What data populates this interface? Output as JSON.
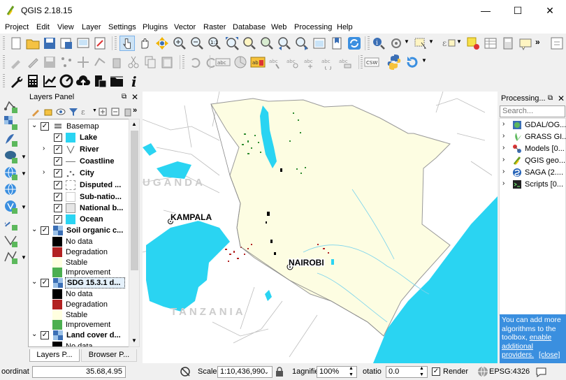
{
  "window": {
    "title": "QGIS 2.18.15",
    "minimize_glyph": "—",
    "maximize_glyph": "☐",
    "close_glyph": "✕"
  },
  "menu": [
    "Project",
    "Edit",
    "View",
    "Layer",
    "Settings",
    "Plugins",
    "Vector",
    "Raster",
    "Database",
    "Web",
    "Processing",
    "Help"
  ],
  "layers_panel": {
    "title": "Layers Panel",
    "layers": [
      {
        "name": "Basemap",
        "type": "group"
      },
      {
        "name": "Lake",
        "type": "layer"
      },
      {
        "name": "River",
        "type": "layer"
      },
      {
        "name": "Coastline",
        "type": "layer"
      },
      {
        "name": "City",
        "type": "layer"
      },
      {
        "name": "Disputed ...",
        "type": "layer"
      },
      {
        "name": "Sub-natio...",
        "type": "layer"
      },
      {
        "name": "National b...",
        "type": "layer"
      },
      {
        "name": "Ocean",
        "type": "layer"
      },
      {
        "name": "Soil organic c...",
        "type": "raster"
      },
      {
        "name": "SDG 15.3.1 d...",
        "type": "raster"
      },
      {
        "name": "Land cover d...",
        "type": "raster"
      }
    ],
    "legend_items": [
      "No data",
      "Degradation",
      "Stable",
      "Improvement"
    ],
    "legend_colors": {
      "no_data": "#000000",
      "degradation": "#b22222",
      "stable": "#ffffe0",
      "improvement": "#4caf50"
    },
    "tabs": [
      "Layers P...",
      "Browser P..."
    ]
  },
  "map": {
    "labels": {
      "kampala": "KAMPALA",
      "nairobi": "NAIROBI",
      "uganda": "UGANDA",
      "tanzania": "TANZANIA"
    },
    "colors": {
      "water": "#2ad4f2",
      "kenya": "#fdfde2",
      "border": "#999999",
      "background": "#ffffff"
    }
  },
  "processing": {
    "title": "Processing...",
    "search_placeholder": "Search...",
    "providers": [
      "GDAL/OG...",
      "GRASS GI...",
      "Models [0...",
      "QGIS geo...",
      "SAGA (2....",
      "Scripts [0..."
    ],
    "info_text": "You can add more algorithms to the toolbox,",
    "info_link": "enable additional providers.",
    "info_close": "[close]",
    "info_bg": "#3a8fdf"
  },
  "status": {
    "coordinate_label": "oordinat",
    "coordinate_value": "35.68,4.95",
    "scale_label": "Scale",
    "scale_value": "1:10,436,990",
    "magnifier_label": "1agnifie",
    "magnifier_value": "100%",
    "rotation_label": "otatio",
    "rotation_value": "0.0",
    "render_label": "Render",
    "crs": "EPSG:4326"
  }
}
